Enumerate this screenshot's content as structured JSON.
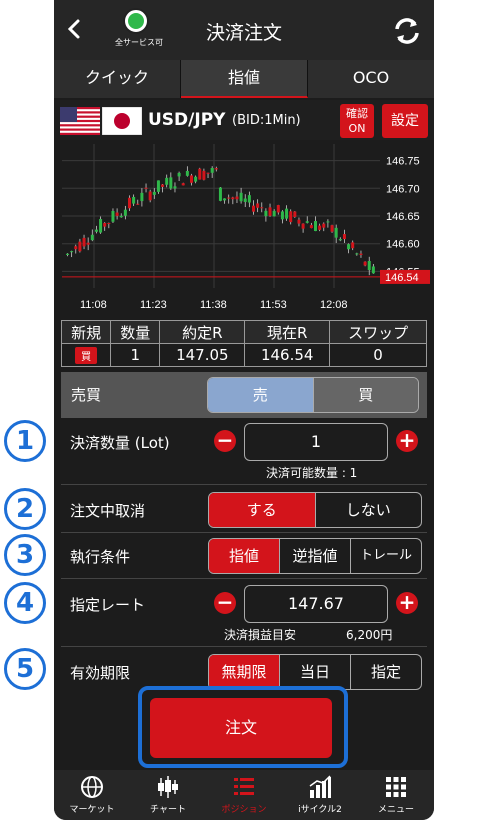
{
  "header": {
    "title": "決済注文",
    "status_label": "全サービス可"
  },
  "tabs": [
    {
      "label": "クイック"
    },
    {
      "label": "指値"
    },
    {
      "label": "OCO"
    }
  ],
  "symbol": {
    "pair": "USD/JPY",
    "sub": "(BID:1Min)",
    "confirm_label_1": "確認",
    "confirm_label_2": "ON",
    "settings_label": "設定"
  },
  "chart_data": {
    "type": "candlestick",
    "x_ticks": [
      "11:08",
      "11:23",
      "11:38",
      "11:53",
      "12:08"
    ],
    "y_ticks": [
      "146.75",
      "146.70",
      "146.65",
      "146.60",
      "146.55"
    ],
    "current_price": "146.54",
    "ylim": [
      146.52,
      146.78
    ]
  },
  "stats": {
    "headers": [
      "新規",
      "数量",
      "約定R",
      "現在R",
      "スワップ"
    ],
    "values": [
      "買",
      "1",
      "147.05",
      "146.54",
      "0"
    ]
  },
  "side": {
    "label": "売買",
    "options": [
      "売",
      "買"
    ],
    "selected": "売"
  },
  "lot": {
    "label": "決済数量 (Lot)",
    "value": "1",
    "note": "決済可能数量 : 1"
  },
  "cancel": {
    "label": "注文中取消",
    "options": [
      "する",
      "しない"
    ],
    "selected": "する"
  },
  "exec": {
    "label": "執行条件",
    "options": [
      "指値",
      "逆指値",
      "トレール"
    ],
    "selected": "指値"
  },
  "rate": {
    "label": "指定レート",
    "value": "147.67",
    "note_label": "決済損益目安",
    "note_value": "6,200円"
  },
  "expiry": {
    "label": "有効期限",
    "options": [
      "無期限",
      "当日",
      "指定"
    ],
    "selected": "無期限"
  },
  "order": {
    "label": "注文"
  },
  "nav": [
    {
      "label": "マーケット",
      "icon": "globe-icon"
    },
    {
      "label": "チャート",
      "icon": "candle-chart-icon"
    },
    {
      "label": "ポジション",
      "icon": "list-icon"
    },
    {
      "label": "iサイクル2",
      "icon": "bar-chart-icon"
    },
    {
      "label": "メニュー",
      "icon": "grid-icon"
    }
  ],
  "markers": [
    "1",
    "2",
    "3",
    "4",
    "5"
  ],
  "colors": {
    "accent": "#d3141b",
    "marker": "#1d6fd6",
    "up": "#2fb84a",
    "down": "#d3141b"
  }
}
